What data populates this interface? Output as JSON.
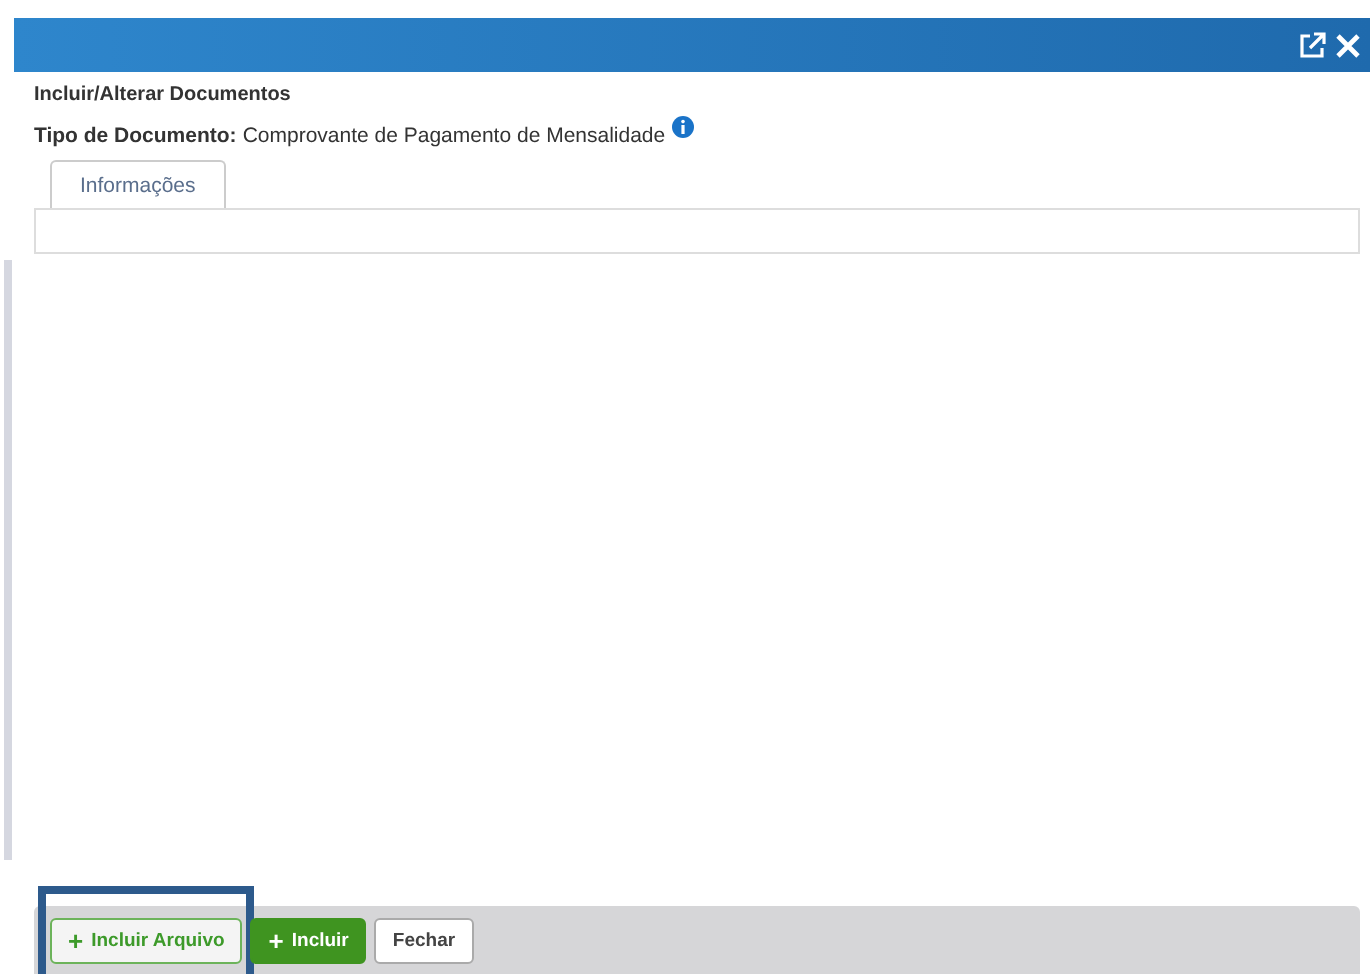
{
  "dialog": {
    "title": "Incluir/Alterar Documentos",
    "document_type_label": "Tipo de Documento:",
    "document_type_value": "Comprovante de Pagamento de Mensalidade"
  },
  "tabs": [
    {
      "label": "Informações",
      "selected": true
    }
  ],
  "buttons": [
    {
      "label": "Incluir Arquivo",
      "kind": "outline",
      "icon": "+",
      "highlighted": true
    },
    {
      "label": "Incluir",
      "kind": "primary",
      "icon": "+",
      "highlighted": false
    },
    {
      "label": "Fechar",
      "kind": "plain",
      "highlighted": false
    }
  ]
}
